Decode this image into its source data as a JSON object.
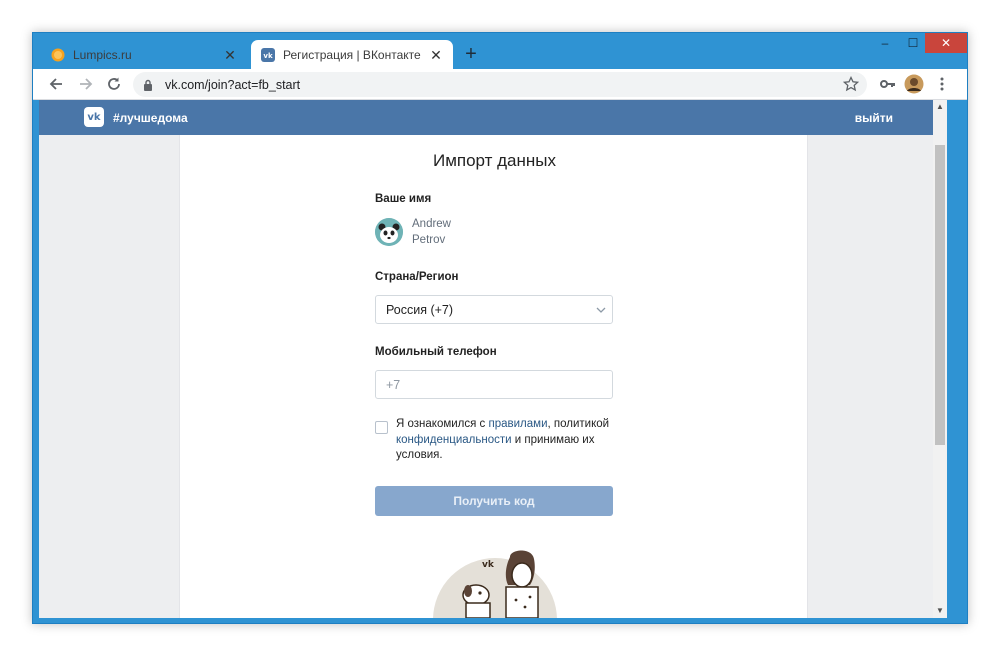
{
  "browser": {
    "tabs": [
      {
        "title": "Lumpics.ru",
        "favicon": "lumpics-orange-icon"
      },
      {
        "title": "Регистрация | ВКонтакте",
        "favicon": "vk-icon"
      }
    ],
    "new_tab_label": "+",
    "url": "vk.com/join?act=fb_start",
    "window_controls": {
      "minimize": "–",
      "maximize": "☐",
      "close": "✕"
    }
  },
  "vk": {
    "logo_text": "vk",
    "hashtag": "#лучшедома",
    "logout": "выйти"
  },
  "form": {
    "title": "Импорт данных",
    "name_label": "Ваше имя",
    "first_name": "Andrew",
    "last_name": "Petrov",
    "country_label": "Страна/Регион",
    "country_value": "Россия (+7)",
    "phone_label": "Мобильный телефон",
    "phone_placeholder": "+7",
    "agree_text_1": "Я ознакомился с ",
    "agree_link_rules": "правилами",
    "agree_text_2": ", политикой ",
    "agree_link_privacy": "конфиденциальности",
    "agree_text_3": " и принимаю их условия.",
    "submit_label": "Получить код"
  },
  "colors": {
    "vk_header": "#4a76a8",
    "button_disabled": "#87a7cd",
    "link": "#2a5885",
    "chrome_frame": "#2f93d3"
  }
}
